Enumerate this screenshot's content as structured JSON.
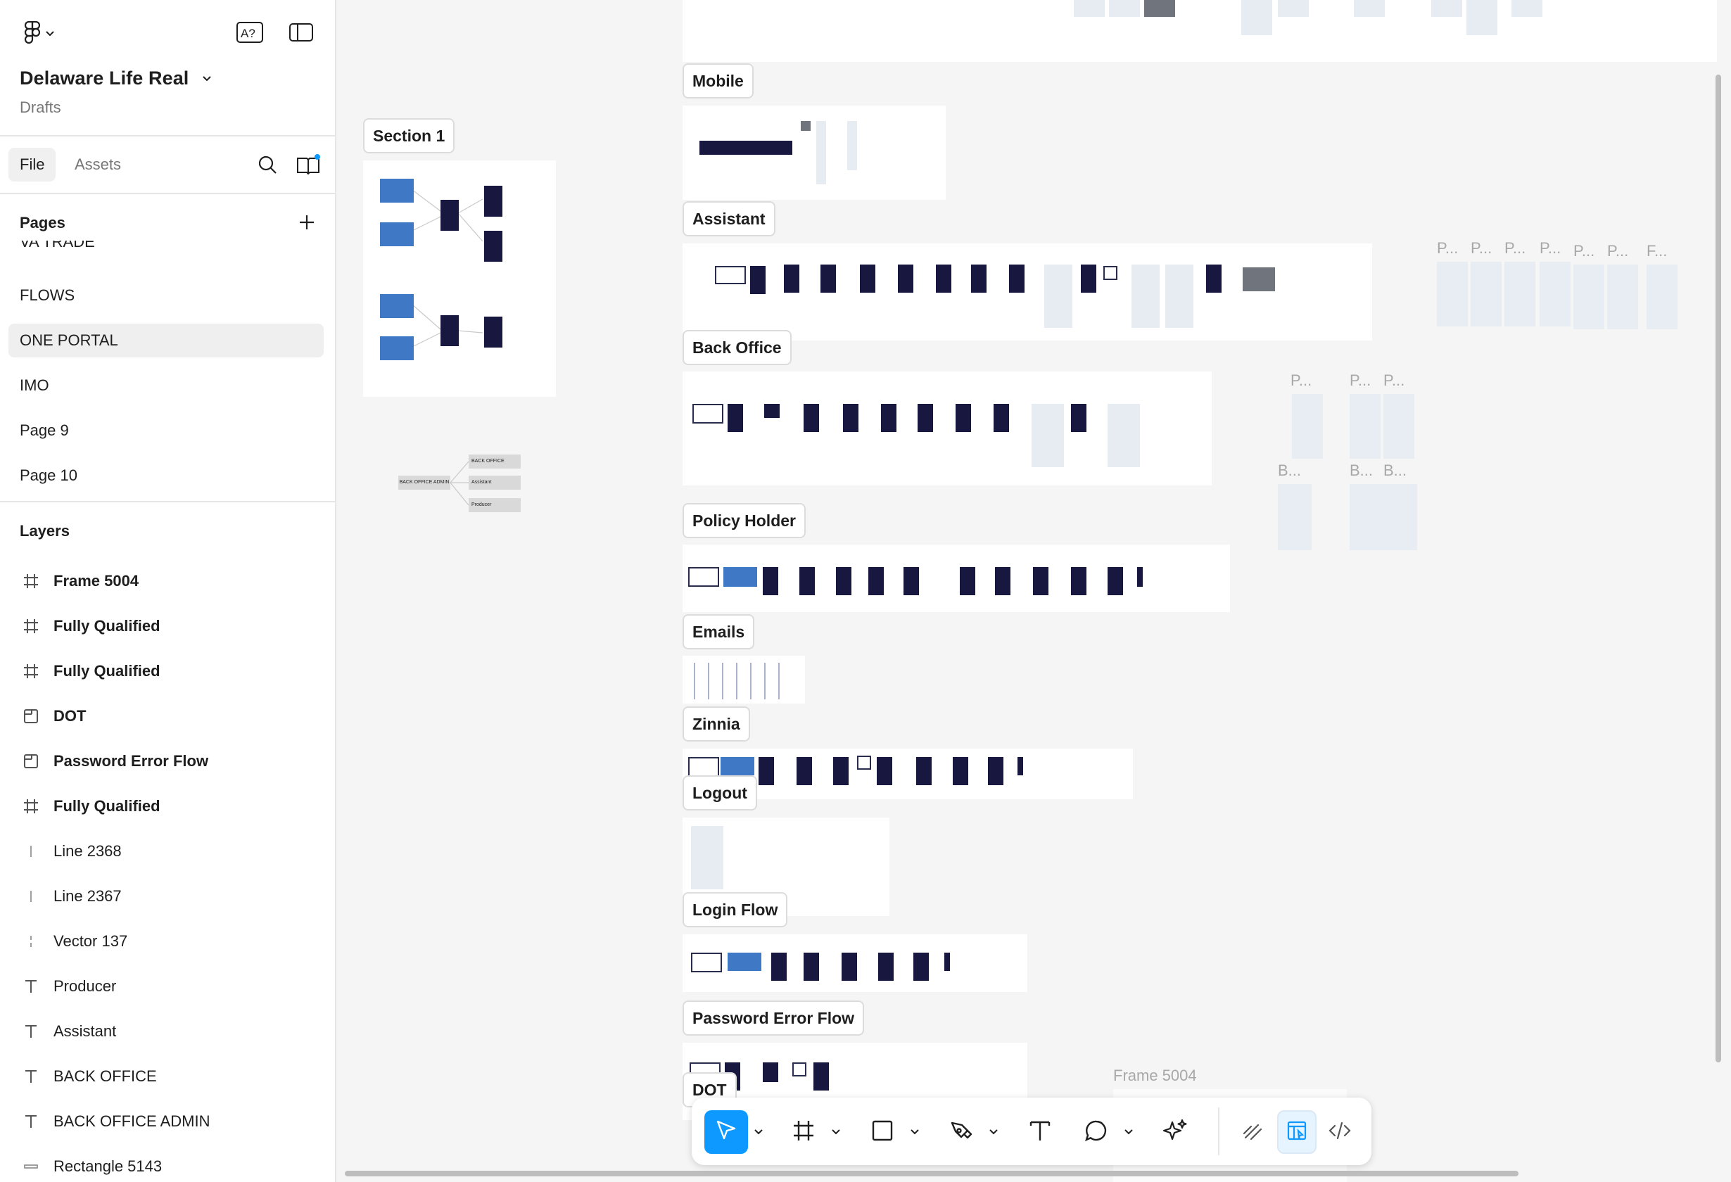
{
  "app": {
    "file_title": "Delaware Life Real",
    "file_location": "Drafts",
    "tabs": [
      "File",
      "Assets"
    ],
    "active_tab": "File",
    "brand_color": "#0d99ff"
  },
  "pages": {
    "heading": "Pages",
    "items": [
      "VA TRADE",
      "FLOWS",
      "ONE PORTAL",
      "IMO",
      "Page 9",
      "Page 10"
    ],
    "selected": "ONE PORTAL"
  },
  "layers": {
    "heading": "Layers",
    "items": [
      {
        "label": "Frame 5004",
        "icon": "frame-icon"
      },
      {
        "label": "Fully Qualified",
        "icon": "frame-icon"
      },
      {
        "label": "Fully Qualified",
        "icon": "frame-icon"
      },
      {
        "label": "DOT",
        "icon": "section-icon"
      },
      {
        "label": "Password Error Flow",
        "icon": "section-icon"
      },
      {
        "label": "Fully Qualified",
        "icon": "frame-icon"
      },
      {
        "label": "Line 2368",
        "icon": "line-icon"
      },
      {
        "label": "Line 2367",
        "icon": "line-icon"
      },
      {
        "label": "Vector 137",
        "icon": "vector-icon"
      },
      {
        "label": "Producer",
        "icon": "text-icon"
      },
      {
        "label": "Assistant",
        "icon": "text-icon"
      },
      {
        "label": "BACK OFFICE",
        "icon": "text-icon"
      },
      {
        "label": "BACK OFFICE ADMIN",
        "icon": "text-icon"
      },
      {
        "label": "Rectangle 5143",
        "icon": "rectangle-icon"
      }
    ]
  },
  "canvas": {
    "sections": {
      "section1": "Section 1",
      "mobile": "Mobile",
      "assistant": "Assistant",
      "back_office": "Back Office",
      "policy_holder": "Policy Holder",
      "emails": "Emails",
      "zinnia": "Zinnia",
      "logout": "Logout",
      "login_flow": "Login Flow",
      "password_error_flow": "Password Error Flow",
      "dot": "DOT"
    },
    "diagram_labels": {
      "back_office": "BACK OFFICE",
      "back_office_admin": "BACK OFFICE ADMIN",
      "assistant": "Assistant",
      "producer": "Producer"
    },
    "ghost_labels": {
      "p1": "P...",
      "p2": "P...",
      "p3": "P...",
      "p4": "P...",
      "p5": "P...",
      "p6": "P...",
      "f1": "F...",
      "p7": "P...",
      "p8": "P...",
      "p9": "P...",
      "b1": "B...",
      "b2": "B...",
      "b3": "B...",
      "frame5004": "Frame 5004"
    }
  },
  "toolbar": {
    "tools": [
      "move-tool",
      "frame-tool",
      "shape-tool",
      "pen-tool",
      "text-tool",
      "comment-tool",
      "actions-tool"
    ],
    "modes": [
      "draw-mode",
      "design-mode",
      "dev-mode"
    ],
    "active_tool": "move-tool",
    "active_mode": "design-mode"
  }
}
